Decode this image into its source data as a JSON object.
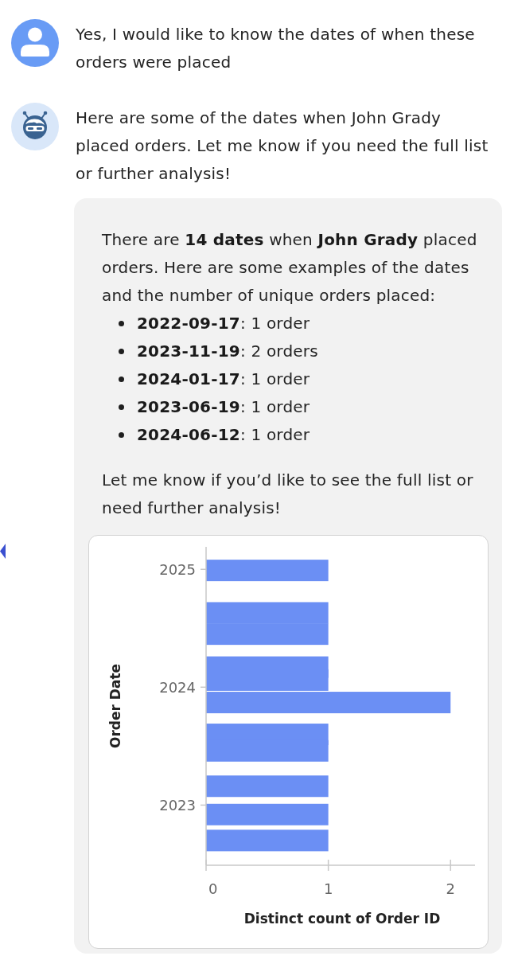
{
  "messages": [
    {
      "kind": "user",
      "text": "Yes, I would like to know the dates of when these orders were placed"
    },
    {
      "kind": "bot",
      "text": "Here are some of the dates when John Grady placed orders. Let me know if you need the full list or further analysis!",
      "card": {
        "intro": "There are **14 dates** when **John Grady** placed orders. Here are some examples of the dates and the number of unique orders placed:",
        "items": [
          "**2022-09-17**: 1 order",
          "**2023-11-19**: 2 orders",
          "**2024-01-17**: 1 order",
          "**2023-06-19**: 1 order",
          "**2024-06-12**: 1 order"
        ],
        "closing": "Let me know if you’d like to see the full list or need further analysis!",
        "chart_data": {
          "type": "bar",
          "orientation": "horizontal",
          "xlabel": "Distinct count of Order ID",
          "ylabel": "Order Date",
          "x": [
            2024.99,
            2024.63,
            2024.45,
            2024.17,
            2024.06,
            2023.87,
            2023.6,
            2023.46,
            2023.16,
            2022.92,
            2022.7
          ],
          "series": [
            {
              "color": "#6b8ff4",
              "values": [
                1,
                1,
                1,
                1,
                1,
                2,
                1,
                1,
                1,
                1,
                1
              ]
            }
          ],
          "xlim": [
            0,
            2.2
          ],
          "ylim": [
            2022.49,
            2025.19
          ],
          "xticks": [
            0,
            1,
            2
          ],
          "yticks": [
            2023,
            2024,
            2025
          ]
        }
      }
    }
  ]
}
